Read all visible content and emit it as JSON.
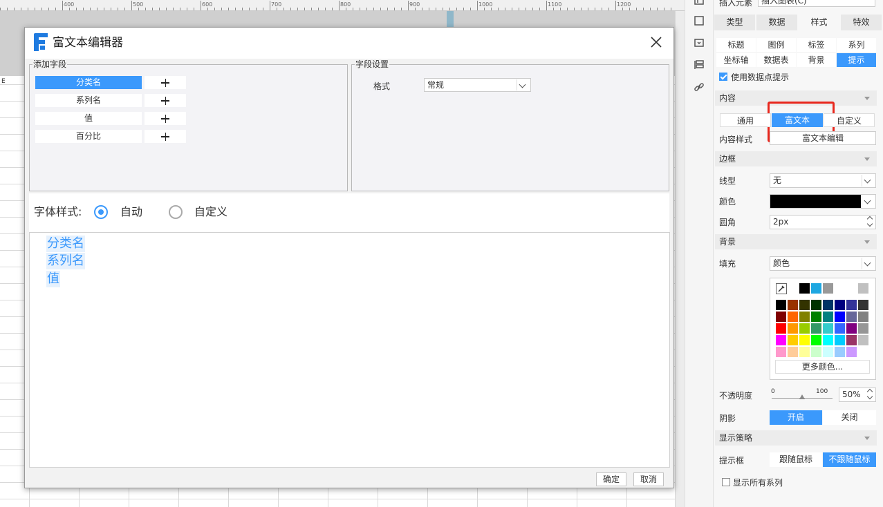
{
  "ruler": {
    "labels": [
      "400",
      "500",
      "600",
      "700",
      "800",
      "900",
      "1000",
      "1100",
      "1200"
    ]
  },
  "sheet": {
    "col_label": "E"
  },
  "dialog": {
    "title": "富文本编辑器",
    "add_fields": {
      "title": "添加字段",
      "items": [
        {
          "label": "分类名",
          "selected": true
        },
        {
          "label": "系列名",
          "selected": false
        },
        {
          "label": "值",
          "selected": false
        },
        {
          "label": "百分比",
          "selected": false
        }
      ]
    },
    "field_settings": {
      "title": "字段设置",
      "format_label": "格式",
      "format_value": "常规"
    },
    "font_style": {
      "label": "字体样式:",
      "options": [
        {
          "label": "自动",
          "selected": true
        },
        {
          "label": "自定义",
          "selected": false
        }
      ]
    },
    "content_lines": [
      "分类名",
      "系列名",
      "值"
    ],
    "ok_label": "确定",
    "cancel_label": "取消"
  },
  "panel": {
    "top_label": "插入元素",
    "top_value": "插入图表(C)",
    "tabs": [
      {
        "label": "类型",
        "selected": false
      },
      {
        "label": "数据",
        "selected": false
      },
      {
        "label": "样式",
        "selected": true
      },
      {
        "label": "特效",
        "selected": false
      }
    ],
    "subtabs": [
      {
        "label": "标题",
        "selected": false
      },
      {
        "label": "图例",
        "selected": false
      },
      {
        "label": "标签",
        "selected": false
      },
      {
        "label": "系列",
        "selected": false
      },
      {
        "label": "坐标轴",
        "selected": false
      },
      {
        "label": "数据表",
        "selected": false
      },
      {
        "label": "背景",
        "selected": false
      },
      {
        "label": "提示",
        "selected": true
      }
    ],
    "use_tooltip": {
      "label": "使用数据点提示",
      "checked": true
    },
    "content": {
      "header": "内容",
      "modes": [
        {
          "label": "通用",
          "selected": false
        },
        {
          "label": "富文本",
          "selected": true
        },
        {
          "label": "自定义",
          "selected": false
        }
      ],
      "style_label": "内容样式",
      "style_button": "富文本编辑"
    },
    "border": {
      "header": "边框",
      "line_label": "线型",
      "line_value": "无",
      "color_label": "颜色",
      "color_value": "#000000",
      "radius_label": "圆角",
      "radius_value": "2px"
    },
    "background": {
      "header": "背景",
      "fill_label": "填充",
      "fill_value": "颜色",
      "recent_colors": [
        "#000000",
        "#1ea7e1",
        "#999999",
        "#ffffff",
        "#ffffff",
        "#c0c0c0"
      ],
      "palette": [
        [
          "#000000",
          "#993300",
          "#333300",
          "#003300",
          "#003366",
          "#000080",
          "#333399",
          "#333333"
        ],
        [
          "#800000",
          "#ff6600",
          "#808000",
          "#008000",
          "#008080",
          "#0000ff",
          "#666699",
          "#808080"
        ],
        [
          "#ff0000",
          "#ff9900",
          "#99cc00",
          "#339966",
          "#33cccc",
          "#3366ff",
          "#800080",
          "#969696"
        ],
        [
          "#ff00ff",
          "#ffcc00",
          "#ffff00",
          "#00ff00",
          "#00ffff",
          "#00ccff",
          "#993366",
          "#c0c0c0"
        ],
        [
          "#ff99cc",
          "#ffcc99",
          "#ffff99",
          "#ccffcc",
          "#ccffff",
          "#99ccff",
          "#cc99ff",
          "#ffffff"
        ]
      ],
      "more_colors": "更多颜色...",
      "opacity_label": "不透明度",
      "opacity_min": "0",
      "opacity_max": "100",
      "opacity_value": "50%",
      "opacity_fraction": 0.5,
      "shadow_label": "阴影",
      "shadow_on": "开启",
      "shadow_off": "关闭",
      "shadow_enabled": true
    },
    "strategy": {
      "header": "显示策略",
      "box_label": "提示框",
      "follow": "跟随鼠标",
      "not_follow": "不跟随鼠标",
      "follow_selected": false,
      "show_all_series": {
        "label": "显示所有系列",
        "checked": false
      }
    }
  }
}
